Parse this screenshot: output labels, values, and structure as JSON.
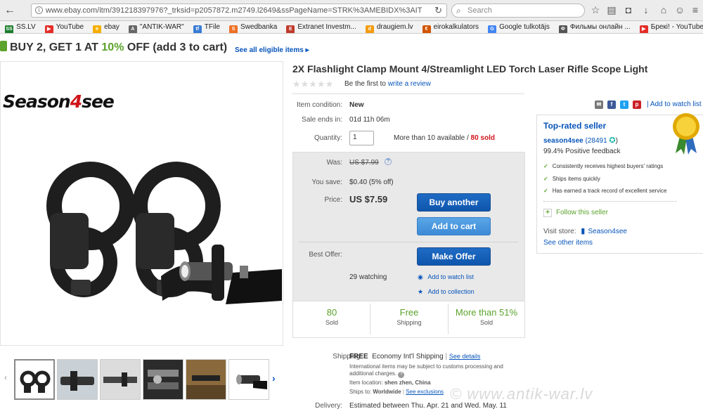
{
  "browser": {
    "url": "www.ebay.com/itm/391218397976?_trksid=p2057872.m2749.l2649&ssPageName=STRK%3AMEBIDX%3AIT",
    "search_placeholder": "Search"
  },
  "bookmarks": [
    {
      "label": "SS.LV",
      "color": "#1a7d2b",
      "glyph": "SS"
    },
    {
      "label": "YouTube",
      "color": "#e52d27",
      "glyph": "▶"
    },
    {
      "label": "ebay",
      "color": "#f5af02",
      "glyph": "e"
    },
    {
      "label": "\"ANTIK-WAR\"",
      "color": "#666666",
      "glyph": "A"
    },
    {
      "label": "TFile",
      "color": "#3a7bd5",
      "glyph": "tf"
    },
    {
      "label": "Swedbanka",
      "color": "#ee7023",
      "glyph": "S"
    },
    {
      "label": "Extranet Investm...",
      "color": "#c0392b",
      "glyph": "E"
    },
    {
      "label": "draugiem.lv",
      "color": "#f39c12",
      "glyph": "d"
    },
    {
      "label": "eirokalkulators",
      "color": "#d35400",
      "glyph": "€"
    },
    {
      "label": "Google tulkotājs",
      "color": "#4285f4",
      "glyph": "G"
    },
    {
      "label": "Фильмы онлайн ...",
      "color": "#555555",
      "glyph": "Ф"
    },
    {
      "label": "Брекі! - YouTube",
      "color": "#e52d27",
      "glyph": "▶"
    }
  ],
  "promo": {
    "prefix": "BUY 2, GET 1 AT ",
    "pct": "10%",
    "suffix": " OFF (add 3 to cart)",
    "link": "See all eligible items"
  },
  "gallery": {
    "brand_a": "Season",
    "brand_b": "4",
    "brand_c": "see"
  },
  "item": {
    "title": "2X Flashlight Clamp Mount 4/Streamlight LED Torch Laser Rifle Scope Light",
    "review_prefix": "Be the first to ",
    "review_link": "write a review",
    "condition_label": "Item condition:",
    "condition": "New",
    "ends_label": "Sale ends in:",
    "ends": "01d 11h 06m",
    "qty_label": "Quantity:",
    "qty": "1",
    "available": "More than 10 available / ",
    "sold": "80 sold",
    "watch_link": "Add to watch list"
  },
  "price": {
    "was_label": "Was:",
    "was": "US $7.99",
    "save_label": "You save:",
    "save": "$0.40 (5% off)",
    "price_label": "Price:",
    "price": "US $7.59",
    "buy_btn": "Buy another",
    "cart_btn": "Add to cart",
    "offer_label": "Best Offer:",
    "offer_btn": "Make Offer",
    "watching": "29 watching",
    "watch_link": "Add to watch list",
    "collection_link": "Add to collection"
  },
  "stats": [
    {
      "value": "80",
      "label": "Sold"
    },
    {
      "value": "Free",
      "label": "Shipping"
    },
    {
      "value": "More than 51%",
      "label": "Sold"
    }
  ],
  "seller": {
    "title": "Top-rated seller",
    "name": "season4see",
    "score": "(28491",
    "score_end": ")",
    "positive": "99.4% Positive feedback",
    "checks": [
      "Consistently receives highest buyers' ratings",
      "Ships items quickly",
      "Has earned a track record of excellent service"
    ],
    "follow": "Follow this seller",
    "store_label": "Visit store:",
    "store": "Season4see",
    "other": "See other items"
  },
  "shipping": {
    "label": "Shipping:",
    "free": "FREE",
    "method": "Economy Int'l Shipping",
    "sep": "| ",
    "details": "See details",
    "note1": "International items may be subject to customs processing and",
    "note2": "additional charges.",
    "location_label": "Item location:",
    "location": "shen zhen, China",
    "ships_label": "Ships to:",
    "ships": "Worldwide",
    "exclusions": "See exclusions",
    "delivery_label": "Delivery:",
    "delivery": "Estimated between Thu. Apr. 21 and Wed. May. 11"
  },
  "watermark": "© www.antik-war.lv",
  "colors": {
    "ebay_blue": "#0654ba",
    "green": "#5ba32b",
    "red": "#d0131a"
  }
}
